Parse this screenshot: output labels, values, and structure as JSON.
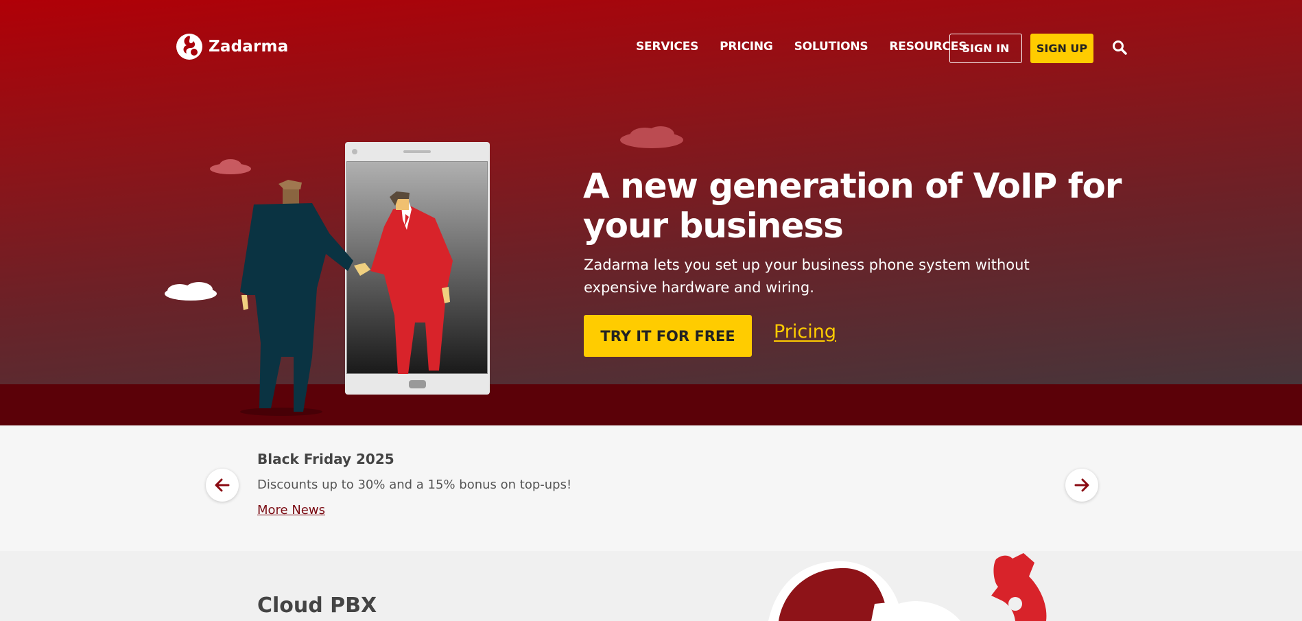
{
  "brand": {
    "name": "Zadarma"
  },
  "nav": {
    "items": [
      {
        "label": "SERVICES"
      },
      {
        "label": "PRICING"
      },
      {
        "label": "SOLUTIONS"
      },
      {
        "label": "RESOURCES"
      }
    ],
    "sign_in": "SIGN IN",
    "sign_up": "SIGN UP",
    "search_icon": "search-icon"
  },
  "hero": {
    "title": "A new generation of VoIP for your business",
    "subtitle": "Zadarma lets you set up your business phone system without expensive hardware and wiring.",
    "cta": "TRY IT FOR FREE",
    "pricing_link": "Pricing"
  },
  "news": {
    "title": "Black Friday 2025",
    "text": "Discounts up to 30% and a 15% bonus on top-ups!",
    "more": "More News"
  },
  "section": {
    "title": "Cloud PBX"
  },
  "colors": {
    "accent": "#ffcc00",
    "brand_red": "#b00007",
    "ground": "#5b0108",
    "link_red": "#7a0a12"
  }
}
